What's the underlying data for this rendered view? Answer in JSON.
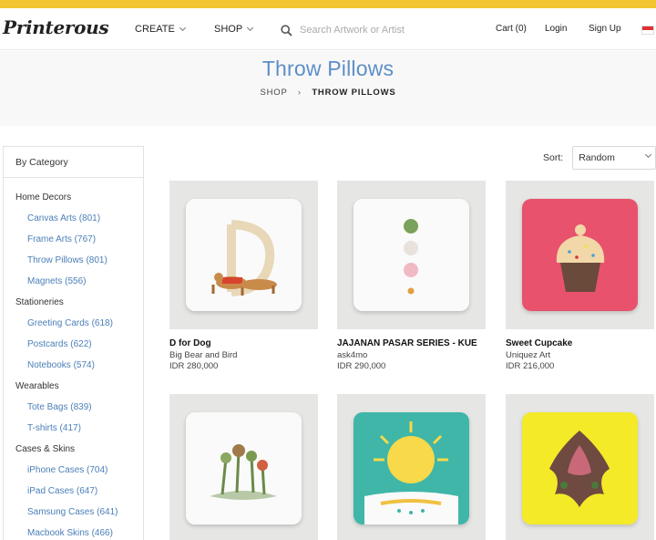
{
  "brand": "Printerous",
  "nav": {
    "create": "CREATE",
    "shop": "SHOP",
    "search_placeholder": "Search Artwork or Artist",
    "cart": "Cart (0)",
    "login": "Login",
    "signup": "Sign Up"
  },
  "colors": {
    "topbar": "#f3c431",
    "accent": "#5d8ec7",
    "link": "#4a7fb8"
  },
  "page": {
    "title": "Throw Pillows",
    "breadcrumb": {
      "root": "SHOP",
      "sep": "›",
      "current": "THROW PILLOWS"
    }
  },
  "sidebar": {
    "heading": "By Category",
    "groups": [
      {
        "name": "Home Decors",
        "items": [
          "Canvas Arts (801)",
          "Frame Arts (767)",
          "Throw Pillows (801)",
          "Magnets (556)"
        ]
      },
      {
        "name": "Stationeries",
        "items": [
          "Greeting Cards (618)",
          "Postcards (622)",
          "Notebooks (574)"
        ]
      },
      {
        "name": "Wearables",
        "items": [
          "Tote Bags (839)",
          "T-shirts (417)"
        ]
      },
      {
        "name": "Cases & Skins",
        "items": [
          "iPhone Cases (704)",
          "iPad Cases (647)",
          "Samsung Cases (641)",
          "Macbook Skins (466)"
        ]
      }
    ]
  },
  "sort": {
    "label": "Sort:",
    "value": "Random"
  },
  "products": [
    {
      "title": "D for Dog",
      "artist": "Big Bear and Bird",
      "price": "IDR 280,000"
    },
    {
      "title": "JAJANAN PASAR SERIES - KUE",
      "artist": "ask4mo",
      "price": "IDR 290,000"
    },
    {
      "title": "Sweet Cupcake",
      "artist": "Uniquez Art",
      "price": "IDR 216,000"
    },
    {
      "title": "",
      "artist": "",
      "price": ""
    },
    {
      "title": "",
      "artist": "",
      "price": ""
    },
    {
      "title": "",
      "artist": "",
      "price": ""
    }
  ]
}
